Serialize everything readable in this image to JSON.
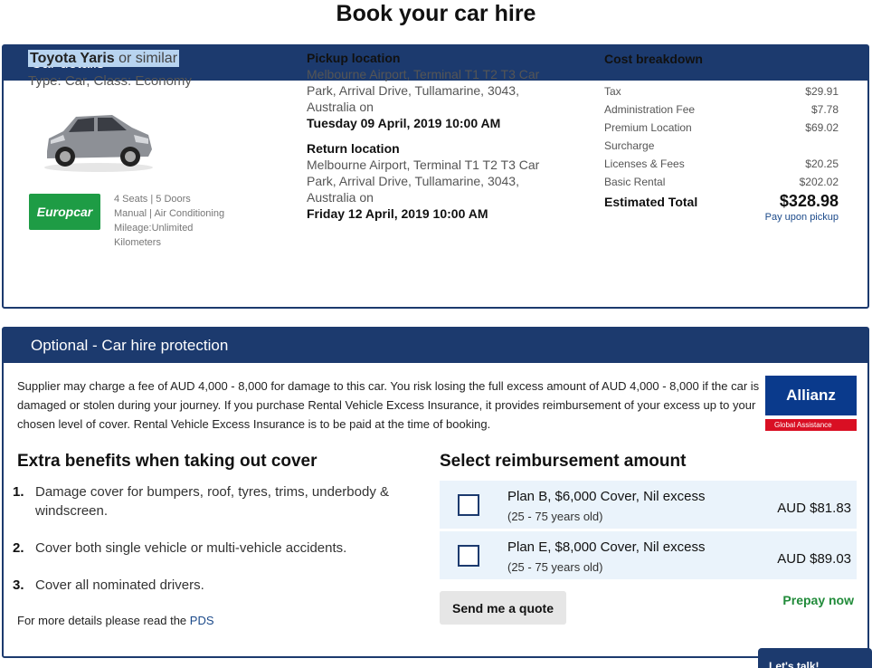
{
  "page_title": "Book your car hire",
  "car_details": {
    "header": "Car details",
    "car_model": "Toyota Yaris",
    "car_similar": "or similar",
    "car_type": "Type: Car, Class: Economy",
    "vendor_logo": "Europcar",
    "specs": [
      "4 Seats | 5 Doors",
      "Manual | Air Conditioning",
      "Mileage:Unlimited",
      "Kilometers"
    ],
    "pickup": {
      "title": "Pickup location",
      "address": "Melbourne Airport, Terminal T1 T2 T3 Car Park, Arrival Drive, Tullamarine, 3043, Australia on",
      "date": "Tuesday 09 April, 2019 10:00 AM"
    },
    "return": {
      "title": "Return location",
      "address": "Melbourne Airport, Terminal T1 T2 T3 Car Park, Arrival Drive, Tullamarine, 3043, Australia on",
      "date": "Friday 12 April, 2019 10:00 AM"
    },
    "cost": {
      "title": "Cost breakdown",
      "rows": [
        {
          "label": "Tax",
          "value": "$29.91"
        },
        {
          "label": "Administration Fee",
          "value": "$7.78"
        },
        {
          "label": "Premium Location Surcharge",
          "value": "$69.02"
        },
        {
          "label": "Licenses & Fees",
          "value": "$20.25"
        },
        {
          "label": "Basic Rental",
          "value": "$202.02"
        }
      ],
      "total_label": "Estimated Total",
      "total_value": "$328.98",
      "pay_note": "Pay upon pickup"
    }
  },
  "protection": {
    "header": "Optional - Car hire protection",
    "description": "Supplier may charge a fee of AUD 4,000 - 8,000 for damage to this car. You risk losing the full excess amount of AUD 4,000 - 8,000 if the car is damaged or stolen during your journey. If you purchase Rental Vehicle Excess Insurance, it provides reimbursement of your excess up to your chosen level of cover. Rental Vehicle Excess Insurance is to be paid at the time of booking.",
    "insurer_logo": "Allianz",
    "insurer_sub": "Global Assistance",
    "benefits_title": "Extra benefits when taking out cover",
    "benefits": [
      {
        "num": "1.",
        "text": "Damage cover for bumpers, roof, tyres, trims, underbody & windscreen."
      },
      {
        "num": "2.",
        "text": "Cover both single vehicle or multi-vehicle accidents."
      },
      {
        "num": "3.",
        "text": "Cover all nominated drivers."
      }
    ],
    "pds_text": "For more details please read the ",
    "pds_link": "PDS",
    "reimb_title": "Select reimbursement amount",
    "plans": [
      {
        "name": "Plan B, $6,000 Cover, Nil excess",
        "age": "(25 - 75 years old)",
        "price": "AUD $81.83"
      },
      {
        "name": "Plan E, $8,000 Cover, Nil excess",
        "age": "(25 - 75 years old)",
        "price": "AUD $89.03"
      }
    ],
    "quote_button": "Send me a quote",
    "prepay": "Prepay now"
  },
  "chat_tab": "Let's talk!",
  "colors": {
    "primary": "#1c3a6e",
    "europcar_green": "#1e9c45",
    "allianz_blue": "#0a3a8c",
    "allianz_red": "#d90f23",
    "prepay_green": "#218b3a",
    "plan_bg": "#eaf3fb"
  }
}
